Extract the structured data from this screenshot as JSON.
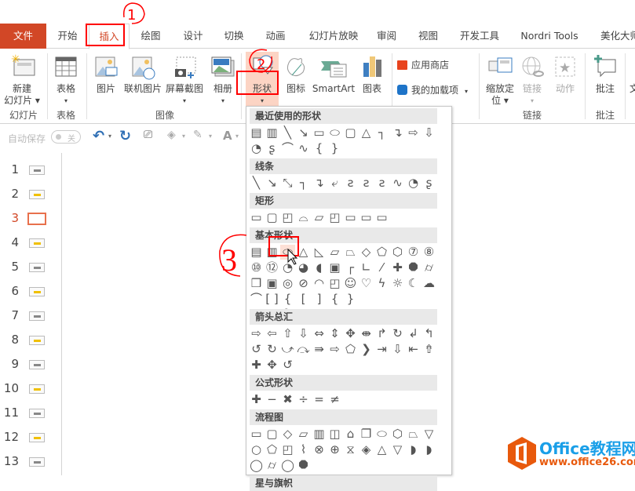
{
  "tabs": [
    {
      "label": "文件"
    },
    {
      "label": "开始"
    },
    {
      "label": "插入"
    },
    {
      "label": "绘图"
    },
    {
      "label": "设计"
    },
    {
      "label": "切换"
    },
    {
      "label": "动画"
    },
    {
      "label": "幻灯片放映"
    },
    {
      "label": "审阅"
    },
    {
      "label": "视图"
    },
    {
      "label": "开发工具"
    },
    {
      "label": "Nordri Tools"
    },
    {
      "label": "美化大师"
    }
  ],
  "ribbon": {
    "new_slide": "新建\n幻灯片 ▾",
    "new_slide_l1": "新建",
    "new_slide_l2": "幻灯片 ▾",
    "table": "表格",
    "picture": "图片",
    "online_picture": "联机图片",
    "screenshot": "屏幕截图",
    "album": "相册",
    "shapes": "形状",
    "icons": "图标",
    "smartart": "SmartArt",
    "chart": "图表",
    "app_store": "应用商店",
    "my_addins": "我的加载项",
    "zoom_l1": "缩放定",
    "zoom_l2": "位 ▾",
    "link": "链接",
    "action": "动作",
    "comment": "批注",
    "text_cut": "文",
    "groups": {
      "slides": "幻灯片",
      "table": "表格",
      "images": "图像",
      "links": "链接",
      "comments": "批注"
    }
  },
  "qat": {
    "autosave": "自动保存",
    "toggle": "关"
  },
  "slides": {
    "numbers": [
      "1",
      "2",
      "3",
      "4",
      "5",
      "6",
      "7",
      "8",
      "9",
      "10",
      "11",
      "12",
      "13"
    ],
    "selected": "3"
  },
  "dropdown": {
    "sections": [
      {
        "title": "最近使用的形状",
        "rows": [
          [
            "▤",
            "▥",
            "╲",
            "↘",
            "▭",
            "⬭",
            "▢",
            "△",
            "┐",
            "↴",
            "⇨",
            "⇩"
          ],
          [
            "◔",
            "ʂ",
            "⌒",
            "∿",
            "{",
            "}"
          ]
        ]
      },
      {
        "title": "线条",
        "rows": [
          [
            "╲",
            "↘",
            "⤡",
            "┐",
            "↴",
            "⤶",
            "ꙅ",
            "ꙅ",
            "ꙅ",
            "∿",
            "◔",
            "ʂ"
          ]
        ]
      },
      {
        "title": "矩形",
        "rows": [
          [
            "▭",
            "▢",
            "◰",
            "⌓",
            "▱",
            "◰",
            "▭",
            "▭",
            "▭"
          ]
        ]
      },
      {
        "title": "基本形状",
        "rows": [
          [
            "▤",
            "▥",
            "⬭",
            "△",
            "◺",
            "▱",
            "⏢",
            "◇",
            "⬠",
            "⬡",
            "⑦",
            "⑧"
          ],
          [
            "⑩",
            "⑫",
            "◔",
            "◕",
            "◖",
            "▣",
            "┌",
            "∟",
            "⁄",
            "✚",
            "⯃",
            "⌭"
          ],
          [
            "❒",
            "▣",
            "◎",
            "⊘",
            "◠",
            "◰",
            "☺",
            "♡",
            "ϟ",
            "☼",
            "☾",
            "☁"
          ],
          [
            "⌒",
            "[ ]",
            "{ }",
            "[",
            "]",
            "{",
            "}"
          ]
        ]
      },
      {
        "title": "箭头总汇",
        "rows": [
          [
            "⇨",
            "⇦",
            "⇧",
            "⇩",
            "⇔",
            "⇕",
            "✥",
            "⇼",
            "↱",
            "↻",
            "↲",
            "↰"
          ],
          [
            "↺",
            "↻",
            "⤻",
            "⤼",
            "⇛",
            "⇨",
            "⬠",
            "❯",
            "⇥",
            "⇩",
            "⇤",
            "⇮"
          ],
          [
            "✚",
            "✥",
            "↺"
          ]
        ]
      },
      {
        "title": "公式形状",
        "rows": [
          [
            "✚",
            "−",
            "✖",
            "÷",
            "=",
            "≠"
          ]
        ]
      },
      {
        "title": "流程图",
        "rows": [
          [
            "▭",
            "▢",
            "◇",
            "▱",
            "▥",
            "◫",
            "⌂",
            "❐",
            "⬭",
            "⬡",
            "⏢",
            "▽"
          ],
          [
            "○",
            "⬠",
            "◰",
            "⌇",
            "⊗",
            "⊕",
            "⧖",
            "◈",
            "△",
            "▽",
            "◗",
            "◗"
          ],
          [
            "◯",
            "⌭",
            "◯",
            "⯃"
          ]
        ]
      },
      {
        "title": "星与旗帜",
        "rows": []
      }
    ]
  },
  "annotations": [
    "1",
    "2",
    "3"
  ],
  "watermark": {
    "brand": "Office教程网",
    "url": "www.office26.com"
  },
  "colors": {
    "accent": "#d24726",
    "annotation": "#ff0000",
    "logo": "#e8590c",
    "watermark_blue": "#1a9fe8"
  }
}
